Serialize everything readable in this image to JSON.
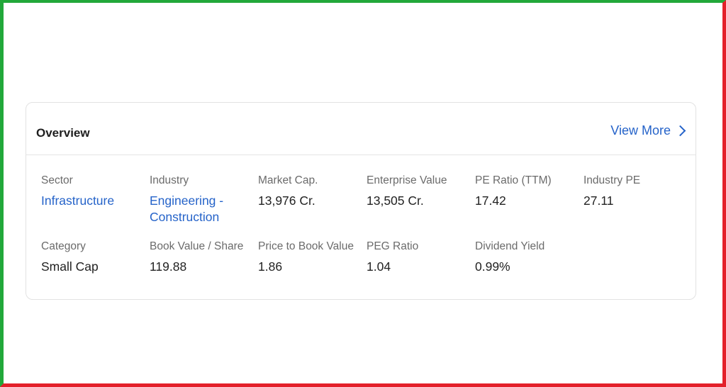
{
  "overview": {
    "title": "Overview",
    "view_more": "View More"
  },
  "metrics": [
    {
      "label": "Sector",
      "value": "Infrastructure",
      "link": true
    },
    {
      "label": "Industry",
      "value": "Engineering - Construction",
      "link": true
    },
    {
      "label": "Market Cap.",
      "value": "13,976 Cr.",
      "link": false
    },
    {
      "label": "Enterprise Value",
      "value": "13,505 Cr.",
      "link": false
    },
    {
      "label": "PE Ratio (TTM)",
      "value": "17.42",
      "link": false
    },
    {
      "label": "Industry PE",
      "value": "27.11",
      "link": false
    },
    {
      "label": "Category",
      "value": "Small Cap",
      "link": false
    },
    {
      "label": "Book Value / Share",
      "value": "119.88",
      "link": false
    },
    {
      "label": "Price to Book Value",
      "value": "1.86",
      "link": false
    },
    {
      "label": "PEG Ratio",
      "value": "1.04",
      "link": false
    },
    {
      "label": "Dividend Yield",
      "value": "0.99%",
      "link": false
    }
  ],
  "colors": {
    "link": "#2563c9",
    "frame_left_top": "#22a83a",
    "frame_right_bottom": "#e3202a"
  },
  "icons": {
    "view_more": "chevron-right-icon"
  }
}
